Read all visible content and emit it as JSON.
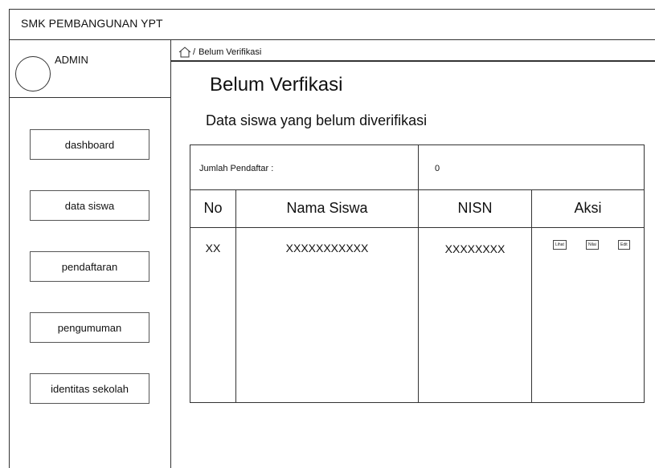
{
  "app": {
    "title": "SMK PEMBANGUNAN YPT"
  },
  "profile": {
    "name": "ADMIN"
  },
  "sidebar": {
    "items": [
      {
        "label": "dashboard"
      },
      {
        "label": "data siswa"
      },
      {
        "label": "pendaftaran"
      },
      {
        "label": "pengumuman"
      },
      {
        "label": "identitas sekolah"
      }
    ]
  },
  "breadcrumb": {
    "icon": "home-icon",
    "separator": "/",
    "current": "Belum Verifikasi"
  },
  "page": {
    "title": "Belum Verfikasi",
    "subtitle": "Data siswa yang belum diverifikasi"
  },
  "summary": {
    "label": "Jumlah Pendaftar :",
    "value": "0"
  },
  "table": {
    "headers": [
      "No",
      "Nama Siswa",
      "NISN",
      "Aksi"
    ],
    "rows": [
      {
        "no": "XX",
        "nama": "XXXXXXXXXXX",
        "nisn": "XXXXXXXX",
        "actions": [
          "Lihat",
          "Nilai",
          "Edit"
        ]
      }
    ]
  }
}
